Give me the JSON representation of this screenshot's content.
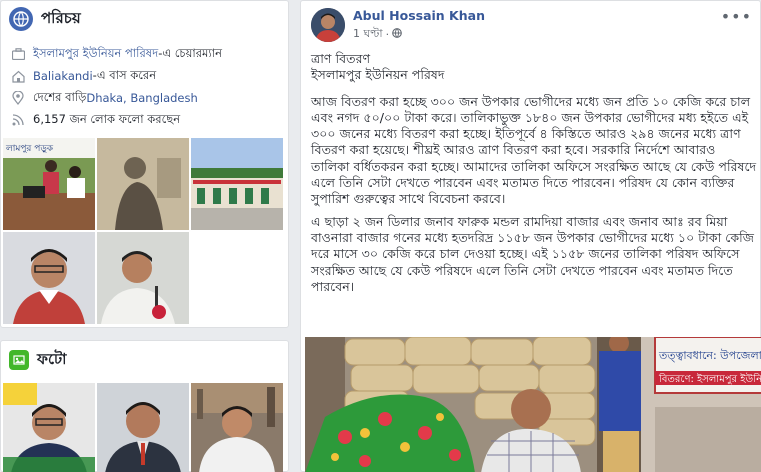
{
  "intro": {
    "title": "পরিচয়",
    "work_prefix": "ইসলামপুর ইউনিয়ন পারিষদ",
    "work_suffix": "-এ চেয়ারম্যান",
    "lives_link": "Baliakandi",
    "lives_suffix": "-এ বাস করেন",
    "from_prefix": "দেশের বাড়ি ",
    "from_link": "Dhaka, Bangladesh",
    "followers": "6,157 জন লোক ফলো করছেন",
    "icons": [
      "briefcase-icon",
      "home-icon",
      "location-pin-icon",
      "rss-icon"
    ]
  },
  "photos": {
    "title": "ফটো"
  },
  "post": {
    "author": "Abul Hossain Khan",
    "time": "1 ঘণ্টা",
    "more": "•••",
    "heading1": "ত্রাণ বিতরণ",
    "heading2": "ইসলামপুর ইউনিয়ন পরিষদ",
    "para1": "আজ বিতরণ করা হচ্ছে ৩০০ জন উপকার ভোগীদের মধ্যে জন প্রতি ১০ কেজি করে চাল এবং নগদ ৫০/০০ টাকা করে। তালিকাভুক্ত ১৮৪০ জন উপকার ভোগীদের মধ্য হইতে এই ৩০০ জনের মধ্যে বিতরণ করা হচ্ছে। ইতিপূর্বে ৪ কিস্তিতে আরও ২৯৪ জনের মধ্যে ত্রাণ বিতরণ করা হয়েছে। শীঘ্রই আরও ত্রাণ বিতরণ করা হবে। সরকারি নির্দেশে আবারও তালিকা বর্ধিতকরন করা হচ্ছে। আমাদের তালিকা অফিসে সংরক্ষিত আছে যে কেউ পরিষদে এলে তিনি সেটা দেখতে পারবেন এবং মতামত দিতে পারবেন। পরিষদ যে কোন ব্যক্তির সুপারিশ গুরুত্বের সাথে বিবেচনা করবে।",
    "para2": "এ ছাড়া ২ জন ডিলার জনাব ফারুক মন্ডল রামদিয়া বাজার এবং জনাব আঃ রব মিয়া বাওনারা বাজার গনের মধ্যে হতদরিদ্র ১১৫৮ জন উপকার ভোগীদের মধ্যে ১০ টাকা কেজি দরে মাসে ৩০ কেজি করে চাল দেওয়া হচ্ছে। এই ১১৫৮ জনের তালিকা পরিষদ অফিসে সংরক্ষিত আছে যে কেউ পরিষদে এলে তিনি সেটা দেখতে পারবেন এবং মতামত দিতে পারবেন।",
    "banner_line1": "তত্ত্বাবধানে: উপজেলা প্র",
    "banner_line2": "বিতরণে: ইসলামপুর ইউনিয়"
  }
}
